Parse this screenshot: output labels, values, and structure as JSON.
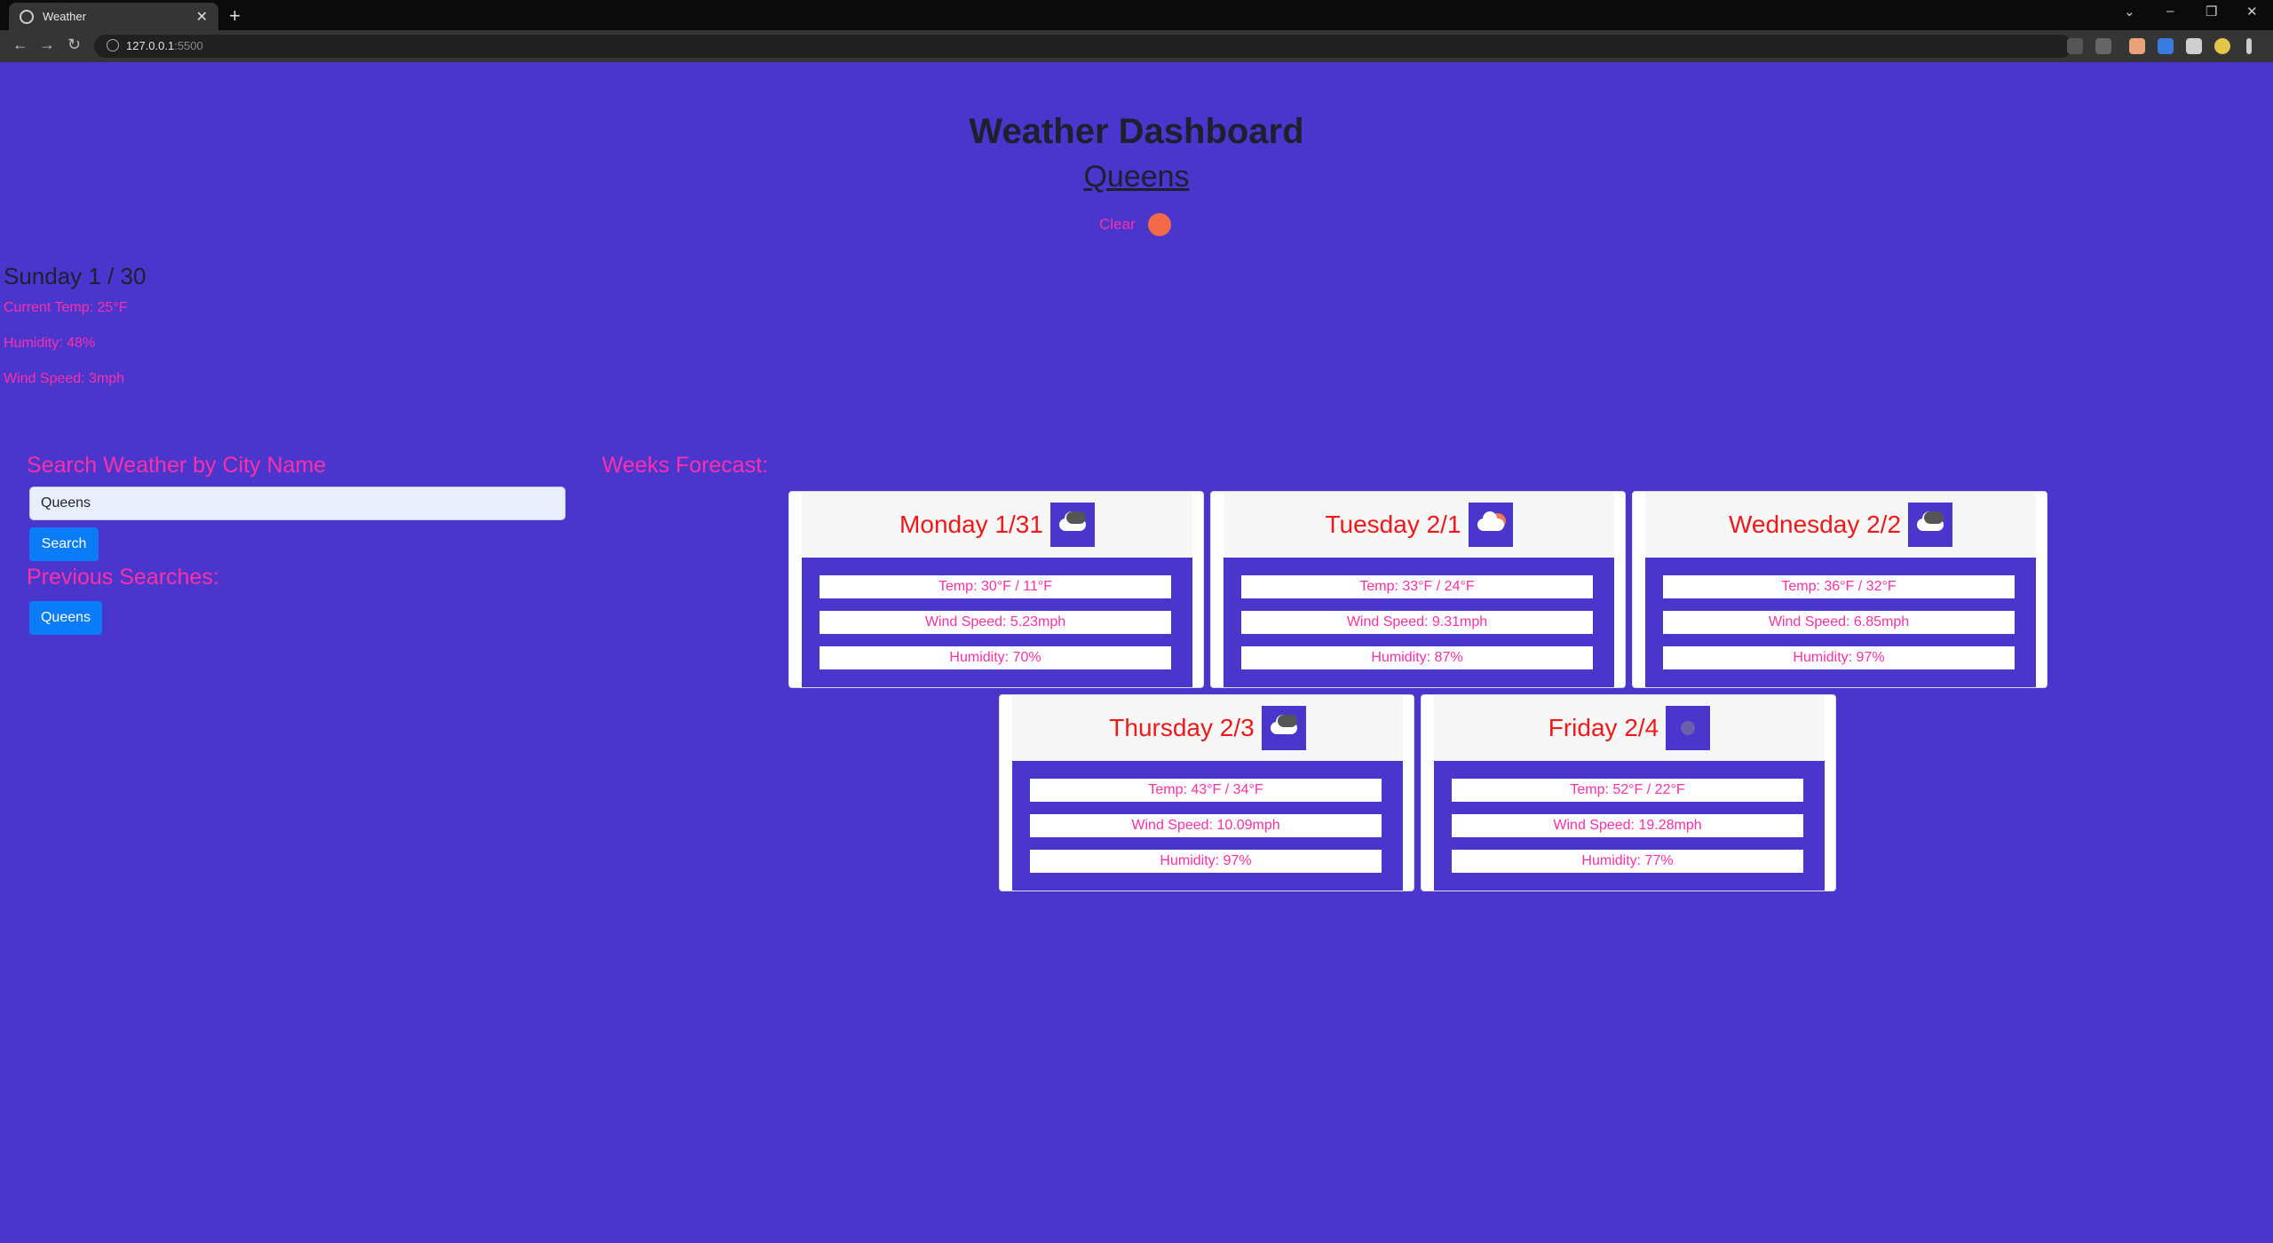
{
  "browser": {
    "tab_title": "Weather",
    "url_host": "127.0.0.1",
    "url_port": ":5500"
  },
  "header": {
    "title": "Weather Dashboard",
    "city": "Queens",
    "clear_label": "Clear"
  },
  "today": {
    "title": "Sunday 1 / 30",
    "current_temp": "Current Temp: 25°F",
    "humidity": "Humidity: 48%",
    "wind_speed": "Wind Speed: 3mph"
  },
  "search": {
    "heading": "Search Weather by City Name",
    "input_value": "Queens",
    "button_label": "Search",
    "previous_heading": "Previous Searches:",
    "previous_items": [
      "Queens"
    ]
  },
  "forecast": {
    "heading": "Weeks Forecast:",
    "days": [
      {
        "day": "Monday 1/31",
        "icon": "cloudy-icon",
        "temp": "Temp: 30°F / 11°F",
        "wind": "Wind Speed: 5.23mph",
        "humidity": "Humidity: 70%"
      },
      {
        "day": "Tuesday 2/1",
        "icon": "partly-sunny-icon",
        "temp": "Temp: 33°F / 24°F",
        "wind": "Wind Speed: 9.31mph",
        "humidity": "Humidity: 87%"
      },
      {
        "day": "Wednesday 2/2",
        "icon": "cloudy-icon",
        "temp": "Temp: 36°F / 32°F",
        "wind": "Wind Speed: 6.85mph",
        "humidity": "Humidity: 97%"
      },
      {
        "day": "Thursday 2/3",
        "icon": "cloudy-icon",
        "temp": "Temp: 43°F / 34°F",
        "wind": "Wind Speed: 10.09mph",
        "humidity": "Humidity: 97%"
      },
      {
        "day": "Friday 2/4",
        "icon": "mist-icon",
        "temp": "Temp: 52°F / 22°F",
        "wind": "Wind Speed: 19.28mph",
        "humidity": "Humidity: 77%"
      }
    ]
  }
}
